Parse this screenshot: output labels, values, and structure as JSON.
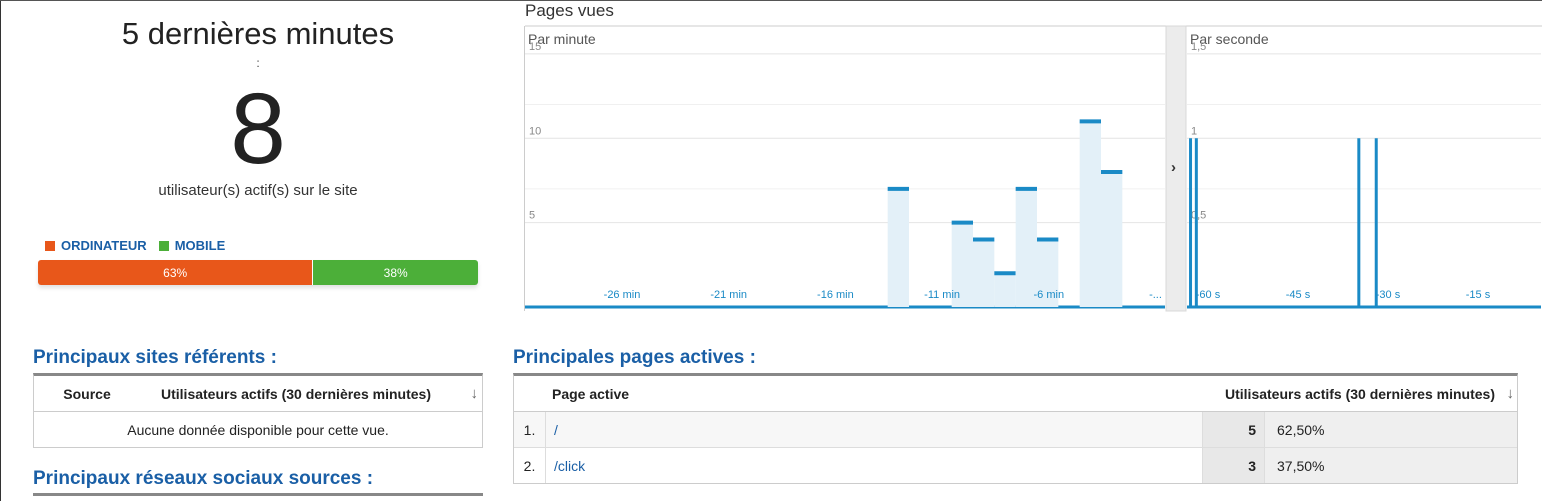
{
  "summary": {
    "title": "5 dernières minutes",
    "colon": ":",
    "active_count": "8",
    "label": "utilisateur(s) actif(s) sur le site",
    "devices": [
      {
        "name": "ORDINATEUR",
        "percent_label": "63%",
        "share": 62.5,
        "color": "#e8571a"
      },
      {
        "name": "MOBILE",
        "percent_label": "38%",
        "share": 37.5,
        "color": "#4caf39"
      }
    ]
  },
  "chart": {
    "title": "Pages vues",
    "accent_color": "#1a8ac6",
    "fill_color": "#e3f0f8",
    "collapse_icon": "chevron-right-icon"
  },
  "chart_data": [
    {
      "type": "bar",
      "title": "Par minute",
      "y_ticks": [
        "15",
        "10",
        "5"
      ],
      "ylim": [
        0,
        16
      ],
      "x_ticks": [
        "-26 min",
        "-21 min",
        "-16 min",
        "-11 min",
        "-6 min",
        "-..."
      ],
      "x_range": [
        -30,
        0
      ],
      "values": [
        {
          "x": -12,
          "y": 7
        },
        {
          "x": -11,
          "y": 0
        },
        {
          "x": -10,
          "y": 0
        },
        {
          "x": -9,
          "y": 5
        },
        {
          "x": -8,
          "y": 4
        },
        {
          "x": -7,
          "y": 2
        },
        {
          "x": -6,
          "y": 7
        },
        {
          "x": -5,
          "y": 4
        },
        {
          "x": -4,
          "y": 0
        },
        {
          "x": -3,
          "y": 11
        },
        {
          "x": -2,
          "y": 8
        },
        {
          "x": -1,
          "y": 0
        }
      ]
    },
    {
      "type": "bar",
      "title": "Par seconde",
      "y_ticks": [
        "1,5",
        "1",
        "0,5"
      ],
      "ylim": [
        0,
        1.6
      ],
      "x_ticks": [
        "-60 s",
        "-45 s",
        "-30 s",
        "-15 s"
      ],
      "x_range": [
        -61,
        0
      ],
      "values": [
        {
          "x": -60,
          "y": 1
        },
        {
          "x": -59,
          "y": 1
        },
        {
          "x": -31,
          "y": 1
        },
        {
          "x": -28,
          "y": 1
        }
      ]
    }
  ],
  "referrers": {
    "title": "Principaux sites référents :",
    "col_source": "Source",
    "col_users": "Utilisateurs actifs (30 dernières minutes)",
    "sort_icon": "↓",
    "empty_text": "Aucune donnée disponible pour cette vue."
  },
  "social": {
    "title": "Principaux réseaux sociaux sources :"
  },
  "active_pages": {
    "title": "Principales pages actives :",
    "col_page": "Page active",
    "col_users": "Utilisateurs actifs (30 dernières minutes)",
    "sort_icon": "↓",
    "rows": [
      {
        "rank": "1.",
        "page": "/",
        "users": "5",
        "pct": "62,50%"
      },
      {
        "rank": "2.",
        "page": "/click",
        "users": "3",
        "pct": "37,50%"
      }
    ]
  }
}
